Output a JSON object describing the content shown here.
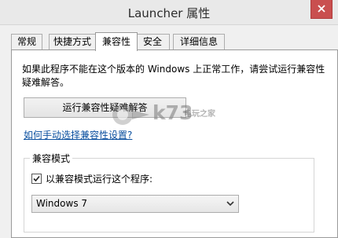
{
  "window": {
    "title": "Launcher 属性",
    "close_icon": "close-icon"
  },
  "tabs": [
    {
      "label": "常规",
      "active": false
    },
    {
      "label": "快捷方式",
      "active": false
    },
    {
      "label": "兼容性",
      "active": true
    },
    {
      "label": "安全",
      "active": false
    },
    {
      "label": "详细信息",
      "active": false
    }
  ],
  "compat": {
    "description": "如果此程序不能在这个版本的 Windows 上正常工作，请尝试运行兼容性疑难解答。",
    "troubleshoot_button": "运行兼容性疑难解答",
    "manual_link": "如何手动选择兼容性设置?",
    "group_title": "兼容模式",
    "checkbox_label": "以兼容模式运行这个程序:",
    "checkbox_checked": true,
    "os_selected": "Windows 7"
  },
  "watermark": {
    "text": "k73",
    "subtext": "电玩之家"
  },
  "colors": {
    "close_button": "#c94f4f",
    "link": "#0a4f9f"
  }
}
